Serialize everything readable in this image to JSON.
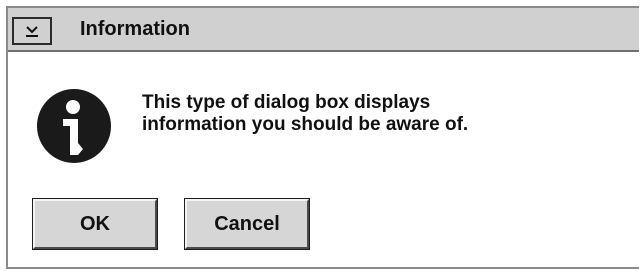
{
  "window": {
    "title": "Information",
    "system_menu_icon": "chevron-down-icon"
  },
  "message": {
    "icon": "info-icon",
    "text": "This type of dialog box displays\ninformation you should be aware of."
  },
  "buttons": {
    "ok_label": "OK",
    "cancel_label": "Cancel"
  },
  "colors": {
    "titlebar": "#d0d0d0",
    "button_face": "#d6d6d6",
    "background": "#ffffff",
    "icon": "#1a1a1a"
  }
}
